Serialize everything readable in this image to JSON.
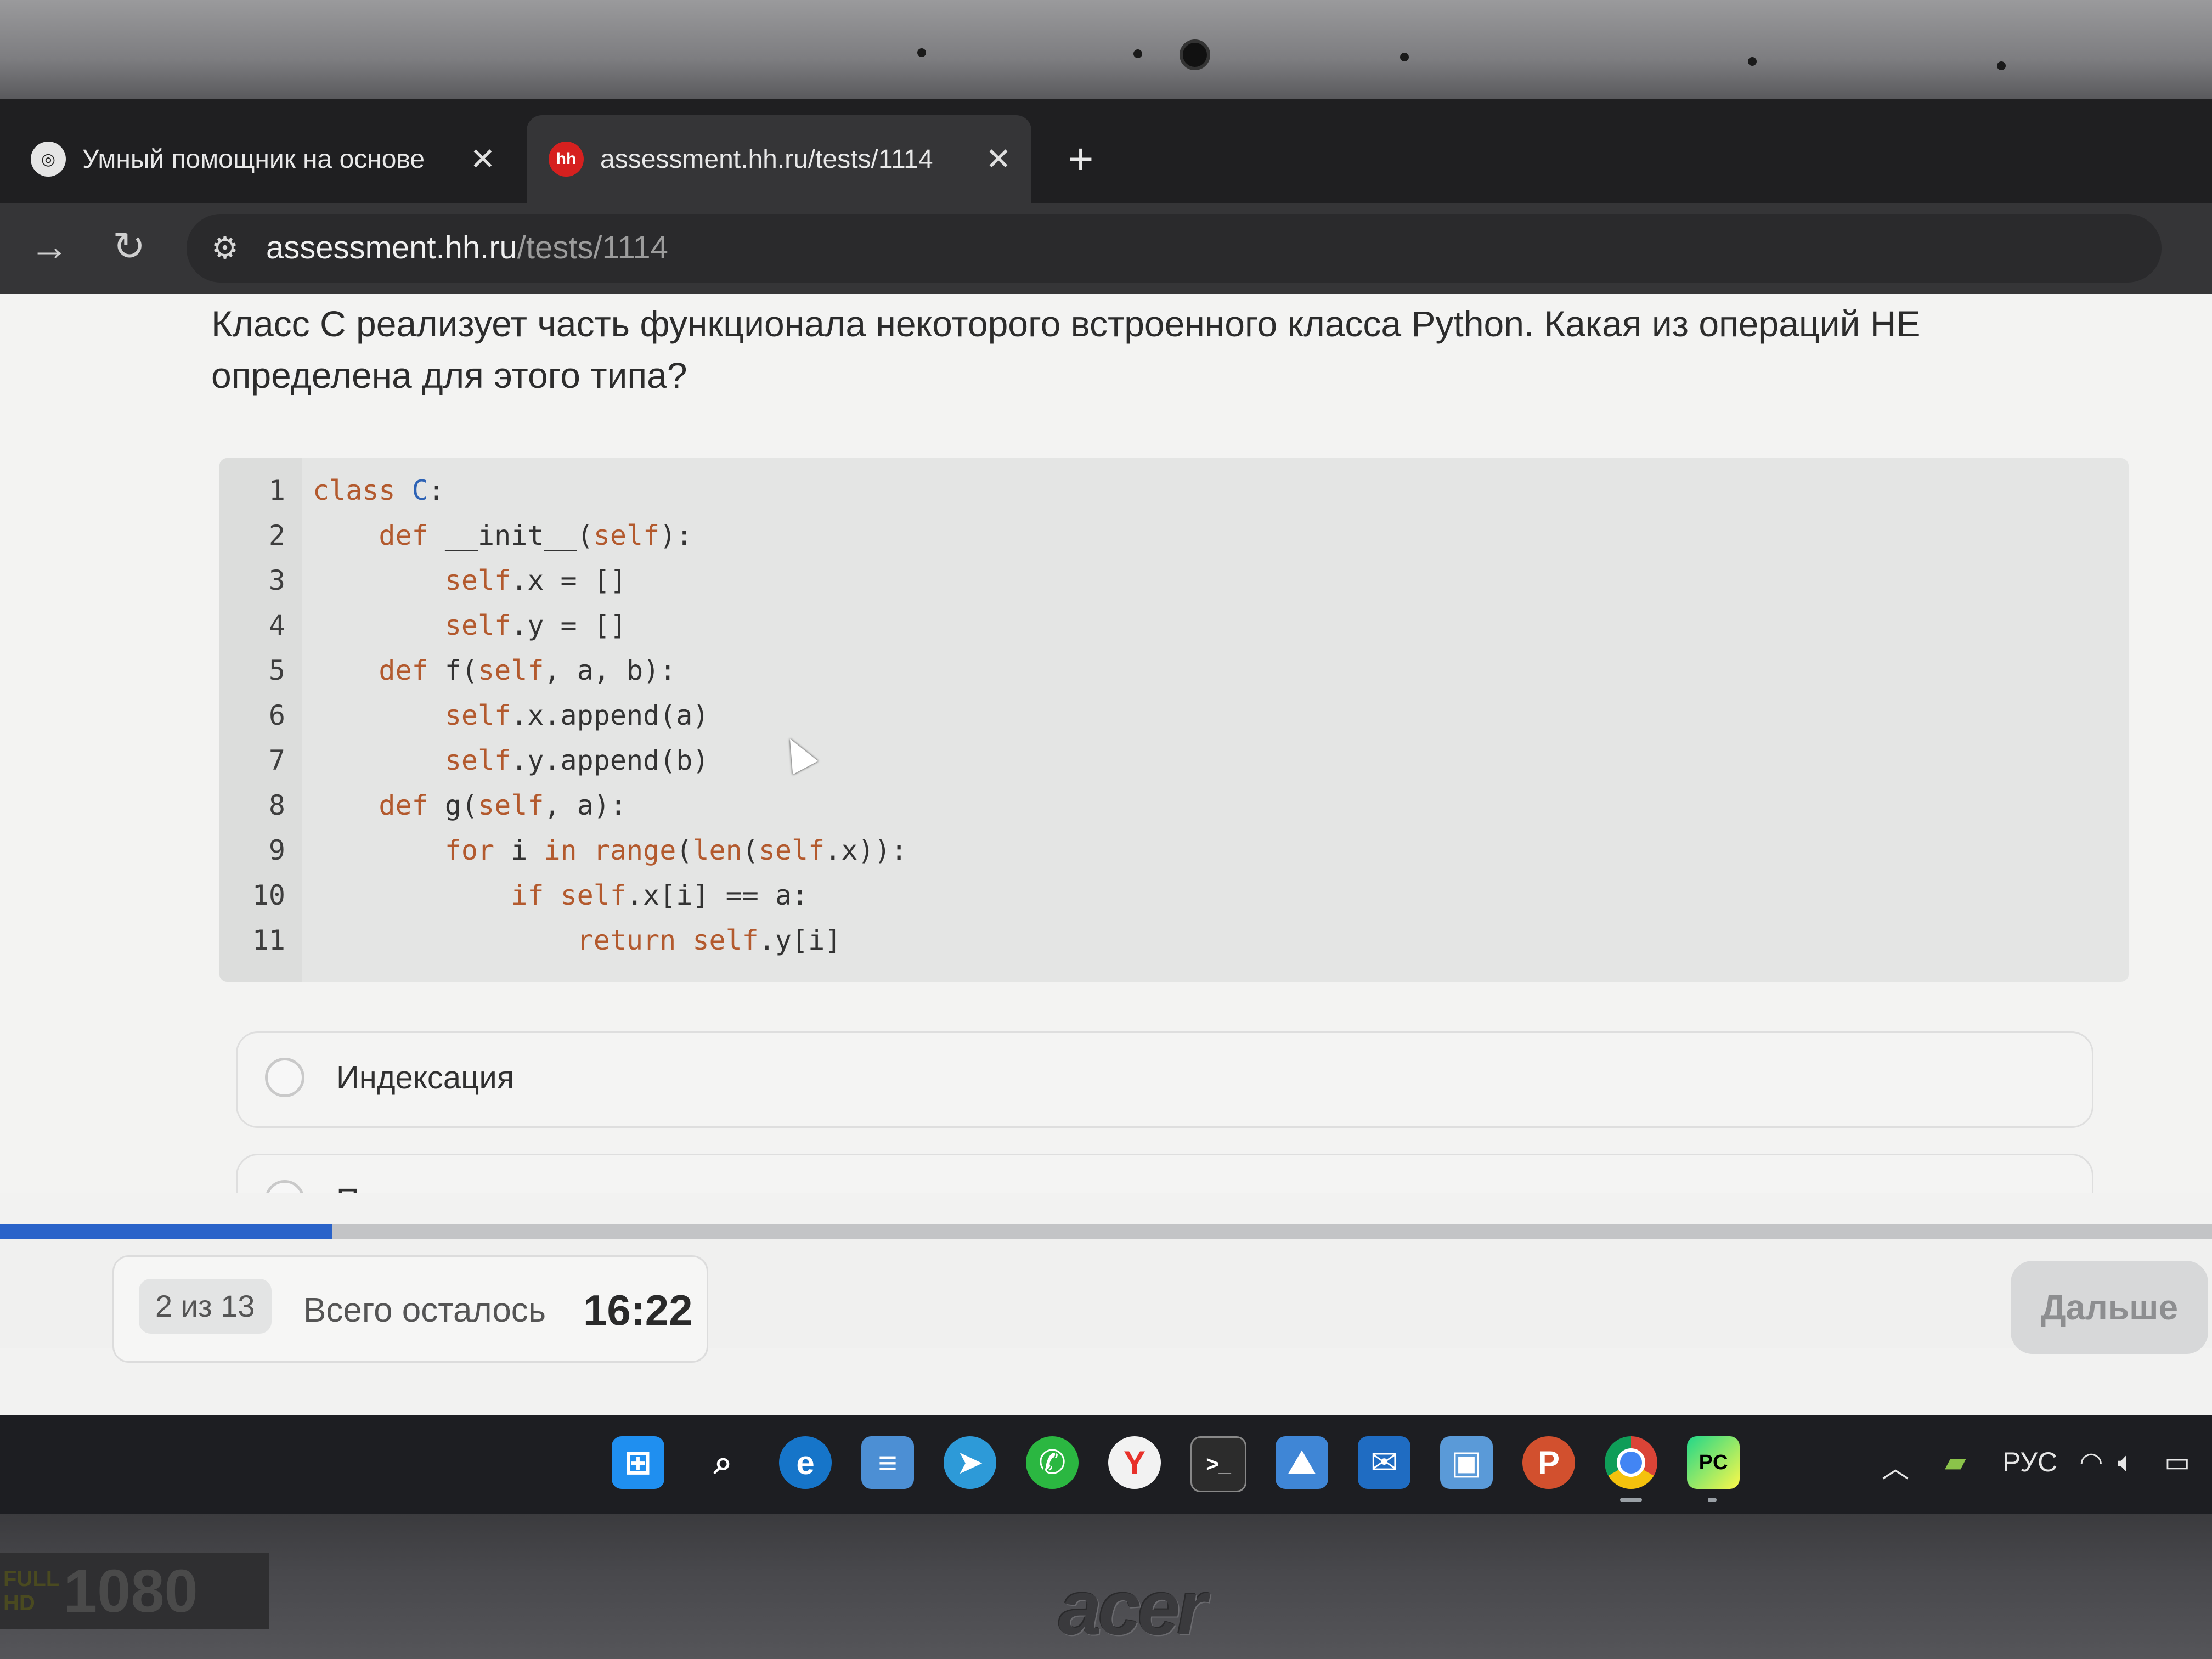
{
  "browser": {
    "tabs": [
      {
        "title": "Умный помощник на основе",
        "close": "✕"
      },
      {
        "title": "assessment.hh.ru/tests/1114",
        "favicon": "hh",
        "close": "✕"
      }
    ],
    "new_tab": "+",
    "url_host": "assessment.hh.ru",
    "url_path": "/tests/1114"
  },
  "question": {
    "text": "Класс C реализует часть функционала некоторого встроенного класса Python. Какая из операций НЕ определена для этого типа?"
  },
  "code": {
    "language": "python",
    "lines": [
      {
        "n": "1",
        "text": "class C:"
      },
      {
        "n": "2",
        "text": "    def __init__(self):"
      },
      {
        "n": "3",
        "text": "        self.x = []"
      },
      {
        "n": "4",
        "text": "        self.y = []"
      },
      {
        "n": "5",
        "text": "    def f(self, a, b):"
      },
      {
        "n": "6",
        "text": "        self.x.append(a)"
      },
      {
        "n": "7",
        "text": "        self.y.append(b)"
      },
      {
        "n": "8",
        "text": "    def g(self, a):"
      },
      {
        "n": "9",
        "text": "        for i in range(len(self.x)):"
      },
      {
        "n": "10",
        "text": "            if self.x[i] == a:"
      },
      {
        "n": "11",
        "text": "                return self.y[i]"
      }
    ]
  },
  "options": [
    {
      "label": "Индексация"
    },
    {
      "label": "Пересечение"
    }
  ],
  "progress": {
    "fraction": 0.15
  },
  "footer": {
    "counter": "2 из 13",
    "remaining_label": "Всего осталось",
    "timer": "16:22",
    "next_label": "Дальше"
  },
  "taskbar": {
    "language": "РУС",
    "icons": [
      "windows-start-icon",
      "search-icon",
      "edge-icon",
      "notepad-icon",
      "telegram-icon",
      "whatsapp-icon",
      "yandex-browser-icon",
      "terminal-icon",
      "photos-icon",
      "outlook-icon",
      "remote-desktop-icon",
      "powerpoint-icon",
      "chrome-icon",
      "pycharm-icon"
    ]
  },
  "device": {
    "brand": "acer",
    "badge_line1": "FULL",
    "badge_line2": "HD",
    "badge_res": "1080"
  },
  "colors": {
    "progress": "#2a63c9",
    "keyword": "#b35a2e",
    "hh_red": "#d6201f"
  }
}
